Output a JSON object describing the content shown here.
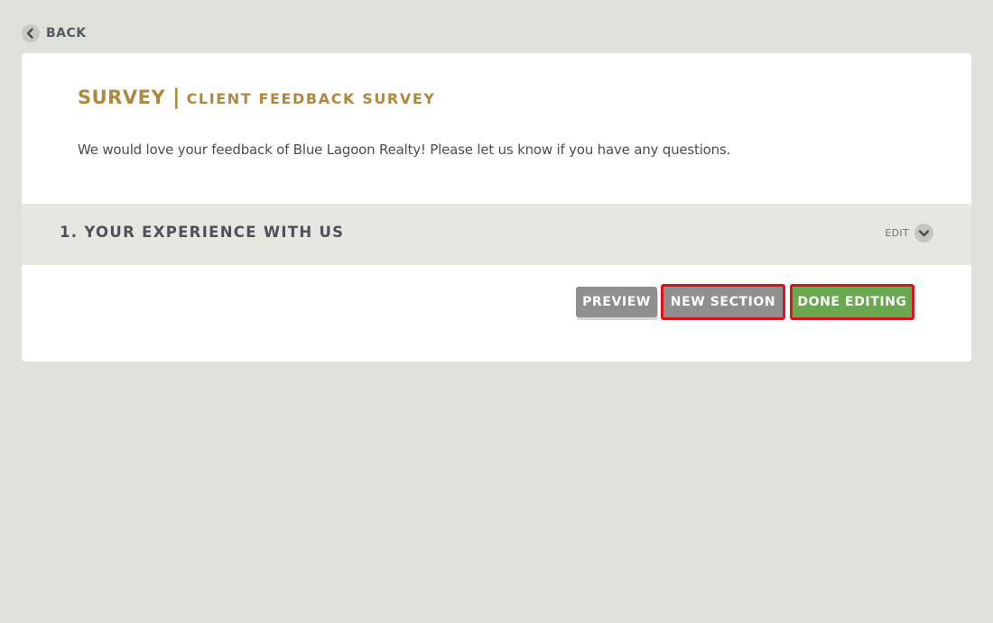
{
  "nav": {
    "back_label": "BACK"
  },
  "survey": {
    "title": "SURVEY",
    "separator": "|",
    "subtitle": "CLIENT FEEDBACK SURVEY",
    "description": "We would love your feedback of Blue Lagoon Realty! Please let us know if you have any questions."
  },
  "sections": [
    {
      "title": "1. YOUR EXPERIENCE WITH US",
      "edit_label": "EDIT"
    }
  ],
  "actions": {
    "preview_label": "PREVIEW",
    "new_section_label": "NEW SECTION",
    "done_editing_label": "DONE EDITING"
  },
  "icons": {
    "back": "chevron-left-icon",
    "edit": "chevron-down-icon"
  },
  "colors": {
    "background": "#e1e1dc",
    "accent_gold": "#b0873e",
    "button_gray": "#8f8f8f",
    "button_green": "#6aa84f",
    "highlight_red": "#e3101b",
    "section_bar": "#e7e7e2"
  }
}
